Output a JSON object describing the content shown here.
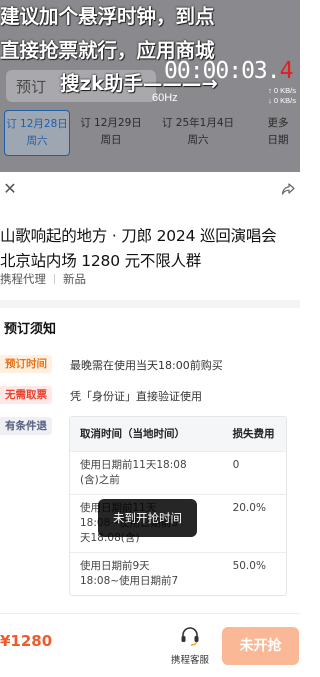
{
  "overlay": {
    "promo_line1": "建议加个悬浮时钟，到点",
    "promo_line2": "直接抢票就行，应用商城",
    "promo_line3": "搜zk助手———→",
    "timer_main": "00:00:03.",
    "timer_last": "4",
    "refresh_rate": "60Hz",
    "net_up": "↑ 0 KB/s",
    "net_down": "↓ 0 KB/s"
  },
  "background": {
    "search_text": "预订",
    "date_tabs": [
      {
        "date": "订 12月28日",
        "weekday": "周六"
      },
      {
        "date": "订 12月29日",
        "weekday": "周日"
      },
      {
        "date": "订 25年1月4日",
        "weekday": "周六"
      },
      {
        "date": "更多",
        "weekday": "日期"
      }
    ]
  },
  "sheet": {
    "title_line1": "山歌响起的地方 · 刀郎 2024 巡回演唱会",
    "title_line2": "北京站内场 1280 元不限人群",
    "meta_vendor": "携程代理",
    "meta_tag": "新品",
    "notice_heading": "预订须知",
    "notices": [
      {
        "tag": "预订时间",
        "text": "最晚需在使用当天18:00前购买"
      },
      {
        "tag": "无需取票",
        "text": "凭「身份证」直接验证使用"
      },
      {
        "tag": "有条件退",
        "text": ""
      }
    ],
    "table": {
      "headers": [
        "取消时间（当地时间）",
        "损失费用"
      ],
      "rows": [
        {
          "time_l1": "使用日期前11天18:08",
          "time_l2": "(含)之前",
          "time_l3": "",
          "fee": "0"
        },
        {
          "time_l1": "使用日期前11天",
          "time_l2": "18:08~使用日期前9",
          "time_l3": "天18:08(含)",
          "fee": "20.0%"
        },
        {
          "time_l1": "使用日期前9天",
          "time_l2": "18:08~使用日期前7",
          "time_l3": "",
          "fee": "50.0%"
        }
      ]
    },
    "toast": "未到开抢时间"
  },
  "bottom": {
    "price": "¥1280",
    "service_label": "携程客服",
    "buy_label": "未开抢"
  },
  "colors": {
    "accent": "#f15b2a",
    "buy_disabled": "#fbb896",
    "timer_highlight": "#e02020"
  }
}
